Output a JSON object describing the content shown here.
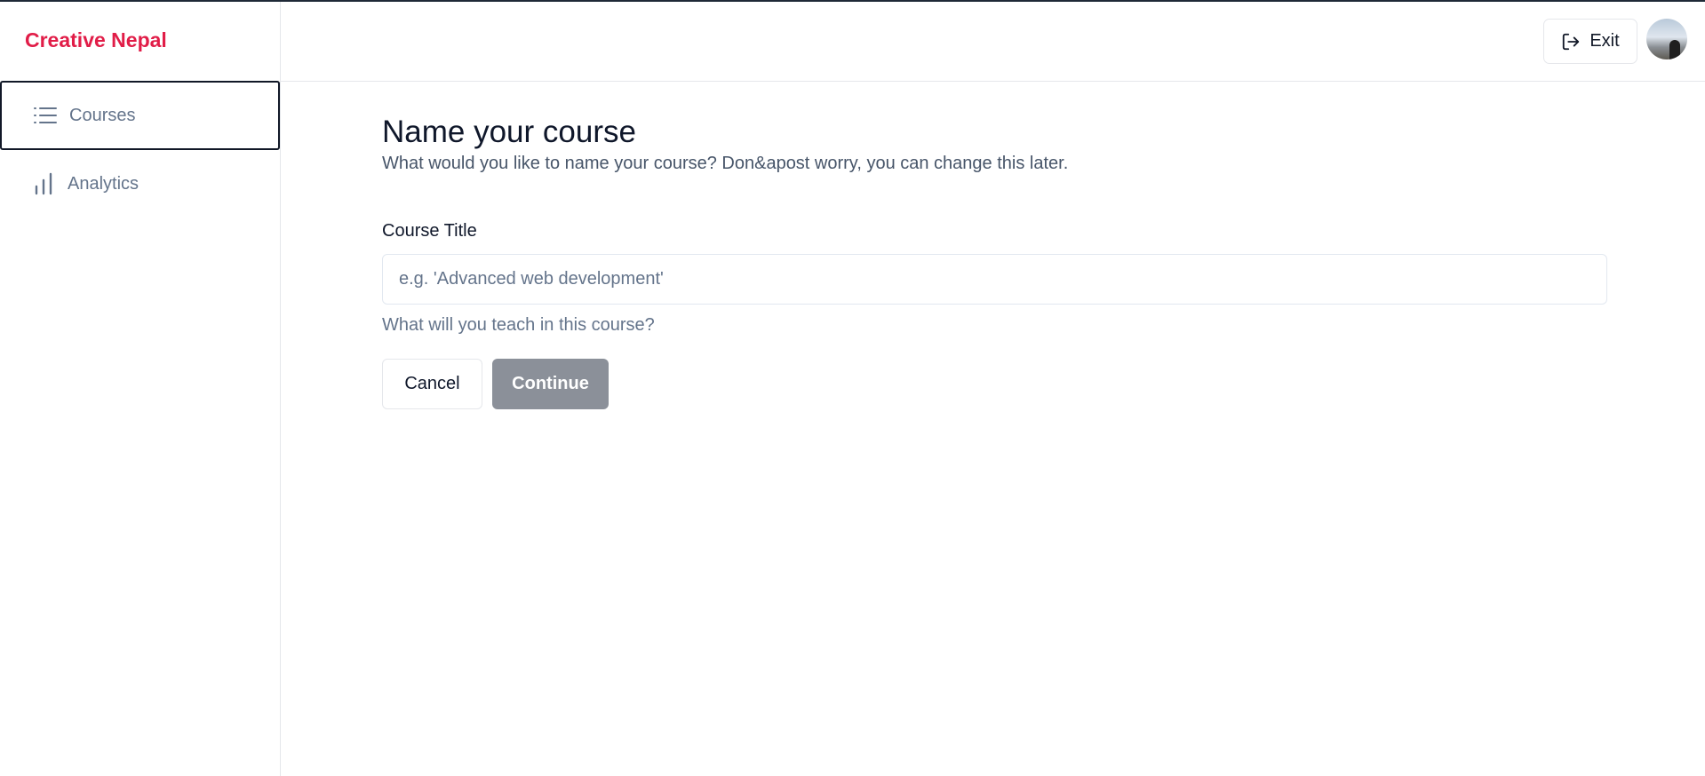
{
  "brand": {
    "name": "Creative Nepal",
    "color": "#e11d48"
  },
  "sidebar": {
    "items": [
      {
        "label": "Courses",
        "icon": "list-icon",
        "active": true
      },
      {
        "label": "Analytics",
        "icon": "bar-chart-icon",
        "active": false
      }
    ]
  },
  "header": {
    "exit_label": "Exit",
    "exit_icon": "log-out-icon",
    "avatar": "user-avatar"
  },
  "main": {
    "title": "Name your course",
    "subtitle": "What would you like to name your course? Don&apost worry, you can change this later.",
    "field": {
      "label": "Course Title",
      "value": "",
      "placeholder": "e.g. 'Advanced web development'",
      "hint": "What will you teach in this course?"
    },
    "actions": {
      "cancel_label": "Cancel",
      "continue_label": "Continue",
      "continue_disabled_color": "#8b9099"
    }
  }
}
